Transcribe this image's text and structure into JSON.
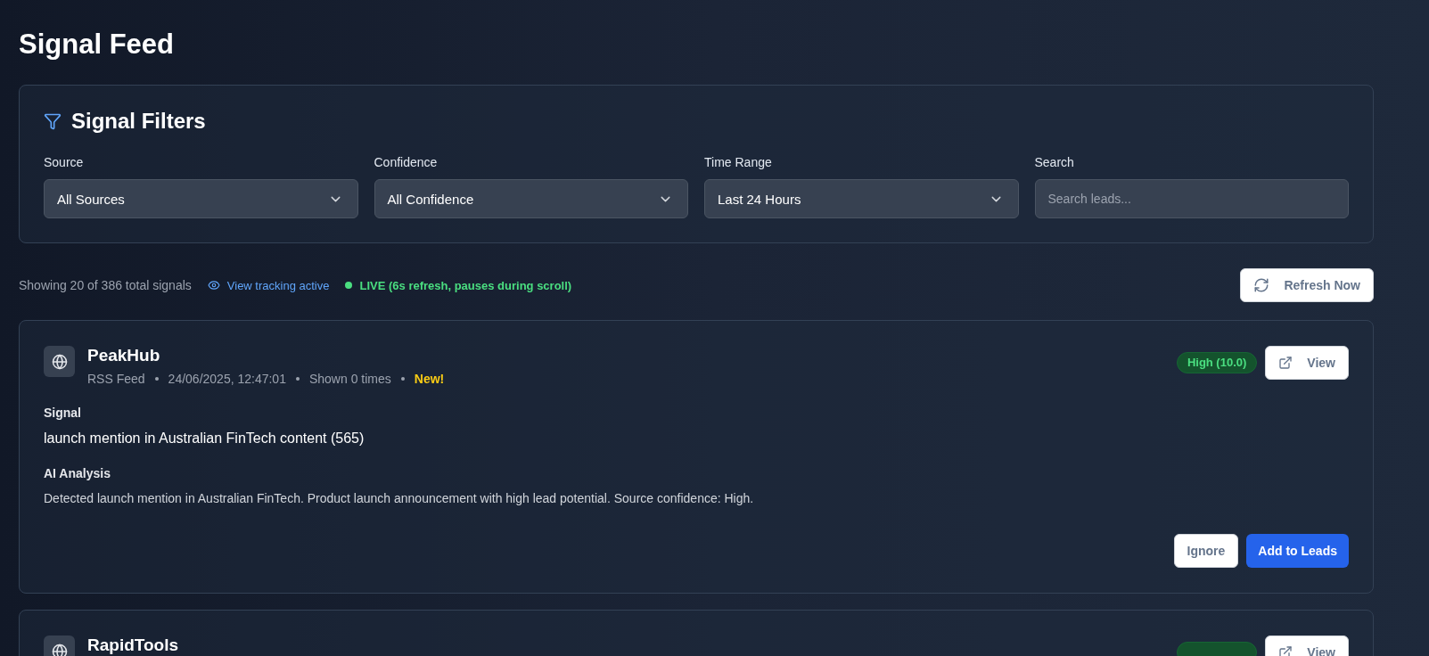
{
  "page_title": "Signal Feed",
  "filters": {
    "title": "Signal Filters",
    "fields": [
      {
        "kind": "select",
        "label": "Source",
        "value": "All Sources"
      },
      {
        "kind": "select",
        "label": "Confidence",
        "value": "All Confidence"
      },
      {
        "kind": "select",
        "label": "Time Range",
        "value": "Last 24 Hours"
      },
      {
        "kind": "input",
        "label": "Search",
        "placeholder": "Search leads..."
      }
    ]
  },
  "status": {
    "summary": "Showing 20 of 386 total signals",
    "tracking": "View tracking active",
    "live": "LIVE (6s refresh, pauses during scroll)",
    "refresh_button": "Refresh Now"
  },
  "signals": [
    {
      "name": "PeakHub",
      "source": "RSS Feed",
      "timestamp": "24/06/2025, 12:47:01",
      "shown": "Shown 0 times",
      "new_label": "New!",
      "confidence": "High (10.0)",
      "view_button": "View",
      "signal_label": "Signal",
      "signal": "launch mention in Australian FinTech content (565)",
      "analysis_label": "AI Analysis",
      "analysis": "Detected launch mention in Australian FinTech. Product launch announcement with high lead potential. Source confidence: High.",
      "actions": [
        "Ignore",
        "Add to Leads"
      ]
    },
    {
      "name": "RapidTools",
      "view_button": "View"
    }
  ]
}
